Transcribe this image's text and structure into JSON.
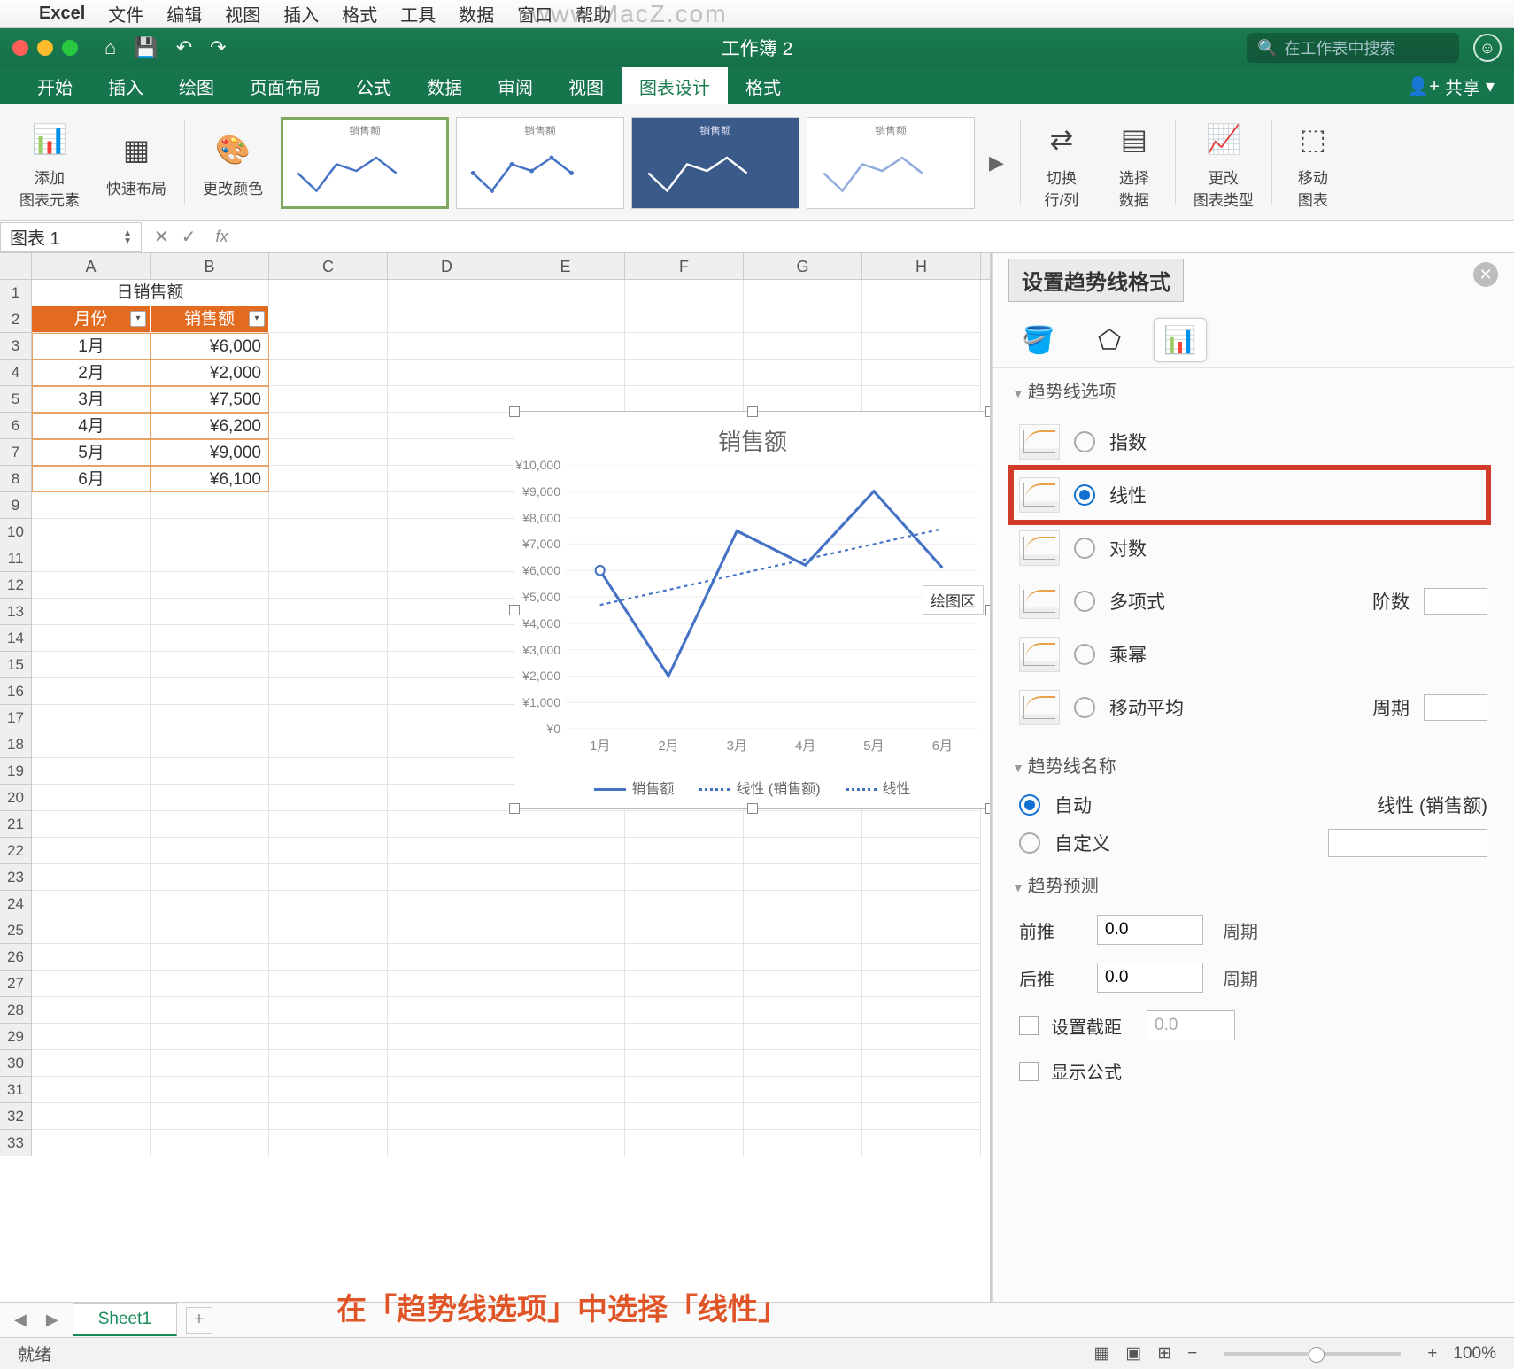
{
  "mac_menu": {
    "app": "Excel",
    "items": [
      "文件",
      "编辑",
      "视图",
      "插入",
      "格式",
      "工具",
      "数据",
      "窗口",
      "帮助"
    ]
  },
  "watermark": "www.MacZ.com",
  "titlebar": {
    "title": "工作簿 2",
    "search_placeholder": "在工作表中搜索"
  },
  "ribbon_tabs": [
    "开始",
    "插入",
    "绘图",
    "页面布局",
    "公式",
    "数据",
    "审阅",
    "视图",
    "图表设计",
    "格式"
  ],
  "ribbon_active": "图表设计",
  "share": "共享",
  "ribbon_groups": {
    "add_element": "添加\n图表元素",
    "quick_layout": "快速布局",
    "change_colors": "更改颜色",
    "switch_rc": "切换\n行/列",
    "select_data": "选择\n数据",
    "change_type": "更改\n图表类型",
    "move_chart": "移动\n图表"
  },
  "namebox": "图表 1",
  "columns": [
    "A",
    "B",
    "C",
    "D",
    "E",
    "F",
    "G",
    "H"
  ],
  "table": {
    "title": "日销售额",
    "headers": [
      "月份",
      "销售额"
    ],
    "rows": [
      [
        "1月",
        "¥6,000"
      ],
      [
        "2月",
        "¥2,000"
      ],
      [
        "3月",
        "¥7,500"
      ],
      [
        "4月",
        "¥6,200"
      ],
      [
        "5月",
        "¥9,000"
      ],
      [
        "6月",
        "¥6,100"
      ]
    ]
  },
  "chart_data": {
    "type": "line",
    "title": "销售额",
    "categories": [
      "1月",
      "2月",
      "3月",
      "4月",
      "5月",
      "6月"
    ],
    "series": [
      {
        "name": "销售额",
        "values": [
          6000,
          2000,
          7500,
          6200,
          9000,
          6100
        ]
      }
    ],
    "trendlines": [
      {
        "name": "线性 (销售额)",
        "type": "linear"
      },
      {
        "name": "线性",
        "type": "linear"
      }
    ],
    "yticks": [
      0,
      1000,
      2000,
      3000,
      4000,
      5000,
      6000,
      7000,
      8000,
      9000,
      10000
    ],
    "ytick_labels": [
      "¥0",
      "¥1,000",
      "¥2,000",
      "¥3,000",
      "¥4,000",
      "¥5,000",
      "¥6,000",
      "¥7,000",
      "¥8,000",
      "¥9,000",
      "¥10,000"
    ],
    "ylim": [
      0,
      10000
    ],
    "tooltip": "绘图区"
  },
  "pane": {
    "title": "设置趋势线格式",
    "section_options": "趋势线选项",
    "options": [
      {
        "key": "exp",
        "label": "指数"
      },
      {
        "key": "linear",
        "label": "线性",
        "selected": true
      },
      {
        "key": "log",
        "label": "对数"
      },
      {
        "key": "poly",
        "label": "多项式",
        "extra_label": "阶数"
      },
      {
        "key": "power",
        "label": "乘幂"
      },
      {
        "key": "movavg",
        "label": "移动平均",
        "extra_label": "周期"
      }
    ],
    "name_section": "趋势线名称",
    "auto": "自动",
    "auto_value": "线性 (销售额)",
    "custom": "自定义",
    "forecast_section": "趋势预测",
    "forward": "前推",
    "backward": "后推",
    "unit": "周期",
    "val": "0.0",
    "intercept": "设置截距",
    "intercept_val": "0.0",
    "show_eq": "显示公式"
  },
  "sheet": {
    "name": "Sheet1"
  },
  "status": {
    "ready": "就绪",
    "zoom": "100%"
  },
  "annotation": "在「趋势线选项」中选择「线性」"
}
